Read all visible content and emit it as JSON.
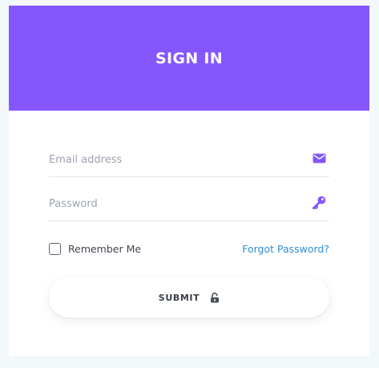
{
  "header": {
    "title": "SIGN IN"
  },
  "form": {
    "email": {
      "placeholder": "Email address",
      "value": "",
      "icon": "envelope-icon"
    },
    "password": {
      "placeholder": "Password",
      "value": "",
      "icon": "key-icon"
    },
    "remember_me": {
      "label": "Remember Me",
      "checked": false
    },
    "forgot_password": {
      "label": "Forgot Password?"
    },
    "submit": {
      "label": "SUBMIT",
      "icon": "unlock-icon"
    }
  },
  "colors": {
    "accent": "#8656fd",
    "link": "#2f8dd8",
    "page_background": "#f3f8fa",
    "card_background": "#ffffff"
  }
}
